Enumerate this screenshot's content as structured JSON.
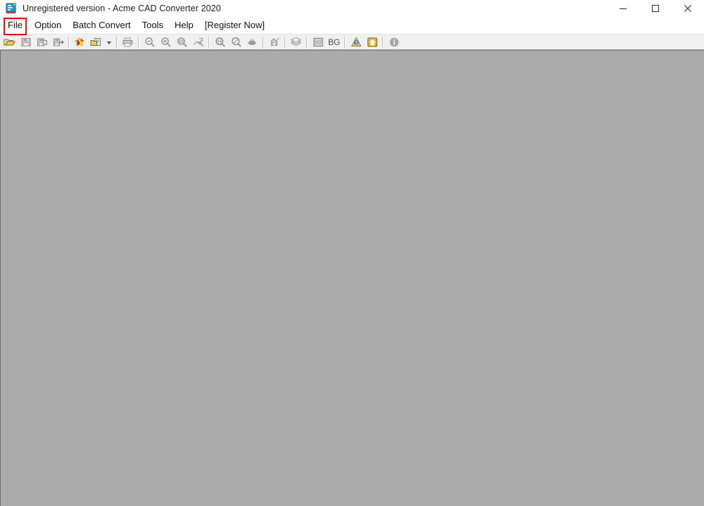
{
  "window": {
    "title": "Unregistered version - Acme CAD Converter 2020",
    "app_icon": "cad-document-icon",
    "controls": {
      "minimize": "minimize-icon",
      "maximize": "maximize-icon",
      "close": "close-icon"
    }
  },
  "menubar": {
    "items": [
      {
        "label": "File",
        "name": "menu-file",
        "highlighted": true
      },
      {
        "label": "Option",
        "name": "menu-option",
        "highlighted": false
      },
      {
        "label": "Batch Convert",
        "name": "menu-batch-convert",
        "highlighted": false
      },
      {
        "label": "Tools",
        "name": "menu-tools",
        "highlighted": false
      },
      {
        "label": "Help",
        "name": "menu-help",
        "highlighted": false
      },
      {
        "label": "[Register Now]",
        "name": "menu-register-now",
        "highlighted": false
      }
    ]
  },
  "highlight": {
    "target": "File",
    "color": "#ee1111"
  },
  "toolbar": {
    "buttons": [
      {
        "name": "open-file-icon",
        "tip": "Open"
      },
      {
        "name": "save-icon",
        "tip": "Save"
      },
      {
        "name": "save-as-icon",
        "tip": "Save As"
      },
      {
        "name": "export-icon",
        "tip": "Export"
      },
      {
        "name": "pdf-convert-icon",
        "tip": "Convert to PDF"
      },
      {
        "name": "batch-convert-icon",
        "tip": "Batch Convert"
      },
      {
        "name": "dropdown-arrow-icon",
        "tip": "More"
      },
      {
        "name": "print-icon",
        "tip": "Print"
      },
      {
        "name": "zoom-out-icon",
        "tip": "Zoom Out"
      },
      {
        "name": "zoom-in-icon",
        "tip": "Zoom In"
      },
      {
        "name": "zoom-window-icon",
        "tip": "Zoom Window"
      },
      {
        "name": "zoom-extents-icon",
        "tip": "Zoom Extents"
      },
      {
        "name": "zoom-all-icon",
        "tip": "Zoom All"
      },
      {
        "name": "zoom-previous-icon",
        "tip": "Zoom Previous"
      },
      {
        "name": "pan-icon",
        "tip": "Pan"
      },
      {
        "name": "measure-icon",
        "tip": "Measure"
      },
      {
        "name": "layers-icon",
        "tip": "Layers"
      },
      {
        "name": "viewport-icon",
        "tip": "Viewport"
      },
      {
        "name": "bg-color-icon",
        "label": "BG",
        "tip": "Background Color"
      },
      {
        "name": "help-question-icon",
        "tip": "Help"
      },
      {
        "name": "home-icon",
        "tip": "Home"
      },
      {
        "name": "about-info-icon",
        "tip": "About"
      }
    ],
    "bg_label": "BG"
  },
  "canvas": {
    "background_color": "#ababab",
    "content": ""
  },
  "colors": {
    "canvas_gray": "#ababab",
    "toolbar_gray": "#f0f0f0",
    "highlight_red": "#ee1111",
    "title_text": "#1c1c1c"
  }
}
